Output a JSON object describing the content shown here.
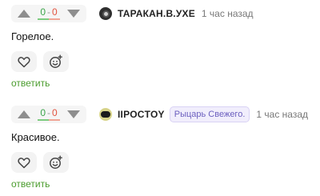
{
  "comments": [
    {
      "score_pos": "0",
      "score_sep": "-",
      "score_neg": "0",
      "username": "ТАРАКАН.В.УХЕ",
      "badge": "",
      "time": "1 час назад",
      "text": "Горелое.",
      "reply_label": "ответить",
      "avatar_icon": "user-avatar-dark"
    },
    {
      "score_pos": "0",
      "score_sep": "-",
      "score_neg": "0",
      "username": "IIPOCTOY",
      "badge": "Рыцарь Свежего.",
      "time": "1 час назад",
      "text": "Красивое.",
      "reply_label": "ответить",
      "avatar_icon": "user-avatar-yellow"
    }
  ],
  "colors": {
    "positive": "#3aa54a",
    "negative": "#e2533f",
    "reply_link": "#4a9c2d",
    "badge_text": "#6c5fbf"
  },
  "icons": {
    "upvote": "upvote-arrow-icon",
    "downvote": "downvote-arrow-icon",
    "like": "heart-icon",
    "emoji": "emoji-add-icon"
  }
}
